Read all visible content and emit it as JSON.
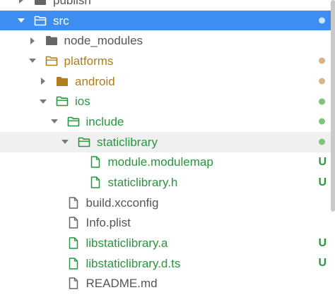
{
  "colors": {
    "default_text": "#555555",
    "selected_bg": "#3d8ef0",
    "selected_text": "#ffffff",
    "modified": "#b07d1c",
    "added": "#27963c",
    "modified_dot": "#d9b38c",
    "added_dot": "#7dc47d",
    "hover_bg": "#f0f0f0"
  },
  "tree": [
    {
      "label": "publish",
      "depth": 0,
      "kind": "folder",
      "arrow": "right",
      "status": "none"
    },
    {
      "label": "src",
      "depth": 0,
      "kind": "folder-open",
      "arrow": "down",
      "status": "selected",
      "selected": true
    },
    {
      "label": "node_modules",
      "depth": 1,
      "kind": "folder",
      "arrow": "right",
      "status": "none"
    },
    {
      "label": "platforms",
      "depth": 1,
      "kind": "folder-open",
      "arrow": "down",
      "status": "modified"
    },
    {
      "label": "android",
      "depth": 2,
      "kind": "folder",
      "arrow": "right",
      "status": "modified"
    },
    {
      "label": "ios",
      "depth": 2,
      "kind": "folder-open",
      "arrow": "down",
      "status": "added"
    },
    {
      "label": "include",
      "depth": 3,
      "kind": "folder-open",
      "arrow": "down",
      "status": "added"
    },
    {
      "label": "staticlibrary",
      "depth": 4,
      "kind": "folder-open",
      "arrow": "down",
      "status": "added",
      "hover": true
    },
    {
      "label": "module.modulemap",
      "depth": 5,
      "kind": "file",
      "arrow": "none",
      "status": "added-file",
      "badge": "U"
    },
    {
      "label": "staticlibrary.h",
      "depth": 5,
      "kind": "file",
      "arrow": "none",
      "status": "added-file",
      "badge": "U"
    },
    {
      "label": "build.xcconfig",
      "depth": 3,
      "kind": "file",
      "arrow": "none",
      "status": "none"
    },
    {
      "label": "Info.plist",
      "depth": 3,
      "kind": "file",
      "arrow": "none",
      "status": "none"
    },
    {
      "label": "libstaticlibrary.a",
      "depth": 3,
      "kind": "file",
      "arrow": "none",
      "status": "added-file",
      "badge": "U"
    },
    {
      "label": "libstaticlibrary.d.ts",
      "depth": 3,
      "kind": "file",
      "arrow": "none",
      "status": "added-file",
      "badge": "U"
    },
    {
      "label": "README.md",
      "depth": 3,
      "kind": "file",
      "arrow": "none",
      "status": "none"
    }
  ]
}
